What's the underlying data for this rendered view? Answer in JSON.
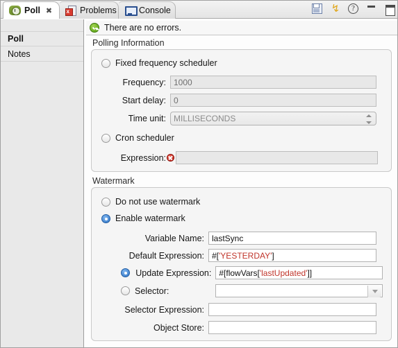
{
  "window": {
    "tabs": [
      {
        "label": "Poll",
        "icon": "clock-icon",
        "active": true,
        "closable": true,
        "close_glyph": "✖"
      },
      {
        "label": "Problems",
        "icon": "problems-icon",
        "active": false
      },
      {
        "label": "Console",
        "icon": "console-icon",
        "active": false
      }
    ],
    "toolbar": {
      "save_title": "Save",
      "sync_glyph": "↯",
      "help_label": "?",
      "minimize_title": "Minimize",
      "maximize_title": "Maximize"
    }
  },
  "sidebar": {
    "items": [
      {
        "label": "Poll",
        "selected": true
      },
      {
        "label": "Notes",
        "selected": false
      }
    ]
  },
  "status": {
    "icon": "ok-icon",
    "message": "There are no errors."
  },
  "polling_information": {
    "title": "Polling Information",
    "fixed_frequency": {
      "radio_label": "Fixed frequency scheduler",
      "selected": false,
      "frequency": {
        "label": "Frequency:",
        "value": "1000",
        "enabled": false
      },
      "start_delay": {
        "label": "Start delay:",
        "value": "0",
        "enabled": false
      },
      "time_unit": {
        "label": "Time unit:",
        "value": "MILLISECONDS",
        "enabled": false
      }
    },
    "cron": {
      "radio_label": "Cron scheduler",
      "selected": false,
      "expression": {
        "label": "Expression:",
        "value": "",
        "enabled": false,
        "error": true
      }
    }
  },
  "watermark": {
    "title": "Watermark",
    "do_not_use": {
      "label": "Do not use watermark",
      "selected": false
    },
    "enable": {
      "label": "Enable watermark",
      "selected": true
    },
    "variable_name": {
      "label": "Variable Name:",
      "value": "lastSync"
    },
    "default_expression": {
      "label": "Default Expression:",
      "value": "#['YESTERDAY']",
      "prefix": "#[",
      "string": "'YESTERDAY'",
      "suffix": "]"
    },
    "update_expression": {
      "label": "Update Expression:",
      "selected": true,
      "value": "#[flowVars['lastUpdated']]",
      "prefix": "#[flowVars[",
      "string": "'lastUpdated'",
      "suffix": "]]"
    },
    "selector": {
      "label": "Selector:",
      "selected": false,
      "value": ""
    },
    "selector_expression": {
      "label": "Selector Expression:",
      "value": ""
    },
    "object_store": {
      "label": "Object Store:",
      "value": ""
    }
  },
  "colors": {
    "accent": "#2f73c4",
    "error": "#c01f13",
    "ok": "#57a012",
    "expression_string": "#c0342a"
  }
}
